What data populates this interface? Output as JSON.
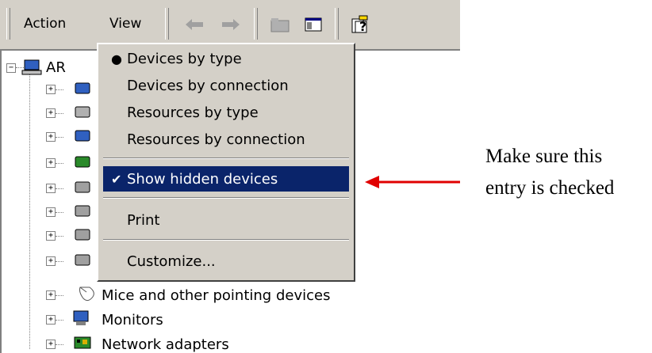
{
  "toolbar": {
    "menus": [
      {
        "label": "Action"
      },
      {
        "label": "View"
      }
    ]
  },
  "tree": {
    "root_label": "AR",
    "items": [
      {
        "label": "Mice and other pointing devices",
        "icon": "mouse-icon"
      },
      {
        "label": "Monitors",
        "icon": "monitor-icon"
      },
      {
        "label": "Network adapters",
        "icon": "network-adapter-icon"
      }
    ]
  },
  "view_menu": {
    "items": [
      {
        "label": "Devices by type",
        "mark": "●"
      },
      {
        "label": "Devices by connection",
        "mark": ""
      },
      {
        "label": "Resources by type",
        "mark": ""
      },
      {
        "label": "Resources by connection",
        "mark": ""
      },
      {
        "label": "Show hidden devices",
        "mark": "✔"
      },
      {
        "label": "Print",
        "mark": ""
      },
      {
        "label": "Customize...",
        "mark": ""
      }
    ],
    "highlight_color": "#0a246a"
  },
  "annotation": {
    "line1": "Make sure this",
    "line2": "entry is checked",
    "arrow_color": "#e00000"
  }
}
